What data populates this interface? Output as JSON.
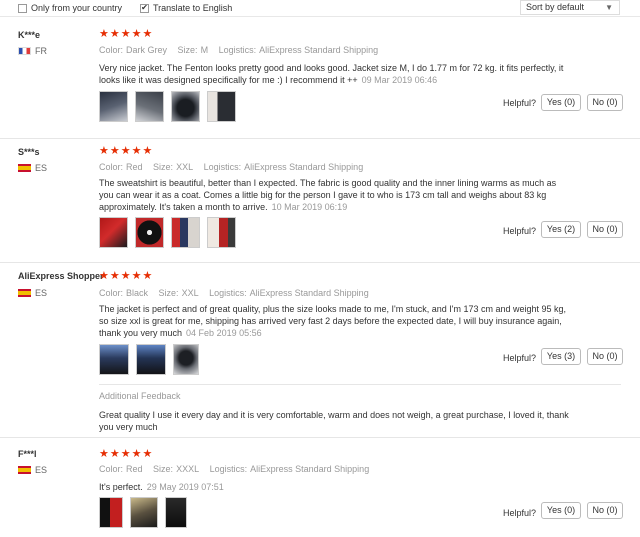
{
  "filters": {
    "country_only": {
      "label": "Only from your country",
      "checked": false
    },
    "translate": {
      "label": "Translate to English",
      "checked": true
    },
    "sort": {
      "value": "Sort by default"
    }
  },
  "labels": {
    "color": "Color:",
    "size": "Size:",
    "logistics": "Logistics:",
    "helpful": "Helpful?",
    "additional_feedback": "Additional Feedback"
  },
  "reviews": [
    {
      "user": "K***e",
      "country": "FR",
      "stars": "★★★★★",
      "color": "Dark Grey",
      "size": "M",
      "logistics": "AliExpress Standard Shipping",
      "text": "Very nice jacket. The Fenton looks pretty good and looks good. Jacket size M, I do 1.77 m for 72 kg. it fits perfectly, it looks like it was designed specifically for me :) I recommend it ++",
      "date": "09 Mar 2019 06:46",
      "yes": "Yes (0)",
      "no": "No (0)"
    },
    {
      "user": "S***s",
      "country": "ES",
      "stars": "★★★★★",
      "color": "Red",
      "size": "XXL",
      "logistics": "AliExpress Standard Shipping",
      "text": "The sweatshirt is beautiful, better than I expected. The fabric is good quality and the inner lining warms as much as you can wear it as a coat. Comes a little big for the person I gave it to who is 173 cm tall and weighs about 83 kg approximately. It's taken a month to arrive.",
      "date": "10 Mar 2019 06:19",
      "yes": "Yes (2)",
      "no": "No (0)"
    },
    {
      "user": "AliExpress Shopper",
      "country": "ES",
      "stars": "★★★★★",
      "color": "Black",
      "size": "XXL",
      "logistics": "AliExpress Standard Shipping",
      "text": "The jacket is perfect and of great quality, plus the size looks made to me, I'm stuck, and I'm 173 cm and weight 95 kg, so size xxl is great for me, shipping has arrived very fast 2 days before the expected date, I will buy insurance again, thank you very much",
      "date": "04 Feb 2019 05:56",
      "yes": "Yes (3)",
      "no": "No (0)",
      "additional": "Great quality I use it every day and it is very comfortable, warm and does not weigh, a great purchase, I loved it, thank you very much"
    },
    {
      "user": "F***l",
      "country": "ES",
      "stars": "★★★★★",
      "color": "Red",
      "size": "XXXL",
      "logistics": "AliExpress Standard Shipping",
      "text": "It's perfect.",
      "date": "29 May 2019 07:51",
      "yes": "Yes (0)",
      "no": "No (0)"
    }
  ],
  "colors": {
    "star": "#e62e04",
    "muted": "#999999",
    "text": "#333333"
  }
}
